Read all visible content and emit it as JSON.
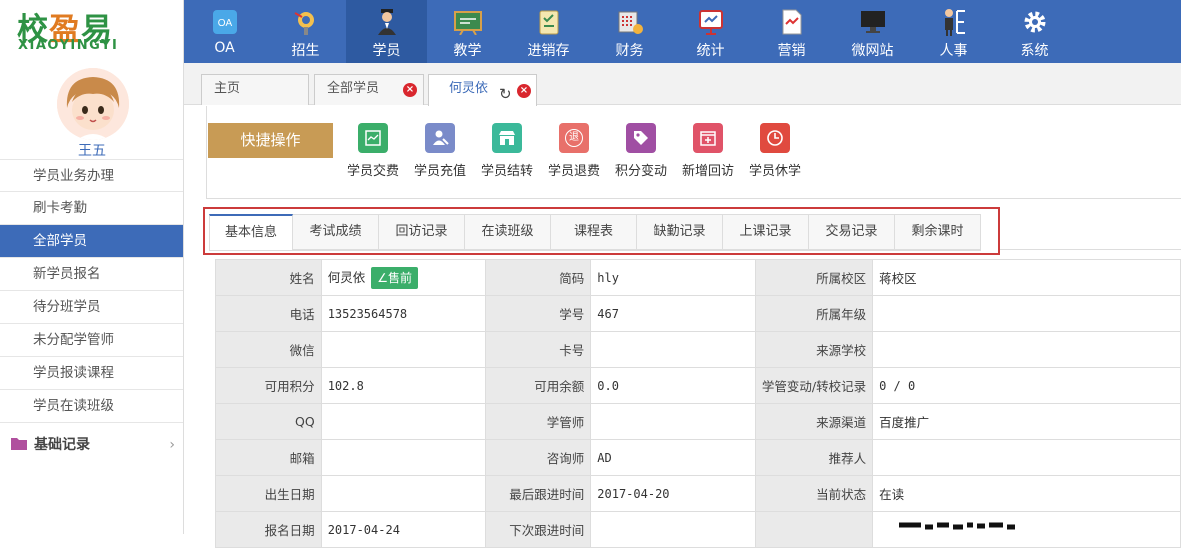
{
  "logo": {
    "cn_left": "校",
    "cn_mid": "盈",
    "cn_right": "易",
    "en": "XIAOYINGYI"
  },
  "nav": [
    {
      "label": "OA",
      "icon": "oa-icon"
    },
    {
      "label": "招生",
      "icon": "recruit-icon"
    },
    {
      "label": "学员",
      "icon": "student-icon",
      "active": true
    },
    {
      "label": "教学",
      "icon": "teaching-icon"
    },
    {
      "label": "进销存",
      "icon": "inventory-icon"
    },
    {
      "label": "财务",
      "icon": "finance-icon"
    },
    {
      "label": "统计",
      "icon": "statistics-icon"
    },
    {
      "label": "营销",
      "icon": "marketing-icon"
    },
    {
      "label": "微网站",
      "icon": "microsite-icon"
    },
    {
      "label": "人事",
      "icon": "hr-icon"
    },
    {
      "label": "系统",
      "icon": "gear-icon"
    }
  ],
  "user": {
    "name": "王五"
  },
  "sidebar": {
    "items": [
      {
        "label": "学员业务办理"
      },
      {
        "label": "刷卡考勤"
      },
      {
        "label": "全部学员",
        "active": true
      },
      {
        "label": "新学员报名"
      },
      {
        "label": "待分班学员"
      },
      {
        "label": "未分配学管师"
      },
      {
        "label": "学员报读课程"
      },
      {
        "label": "学员在读班级"
      }
    ],
    "group": {
      "label": "基础记录",
      "arrow": "›"
    }
  },
  "page_tabs": [
    {
      "label": "主页"
    },
    {
      "label": "全部学员",
      "close": "×"
    },
    {
      "label": "何灵依",
      "close": "×",
      "refresh": "↻",
      "active": true
    }
  ],
  "quick": {
    "main_label": "快捷操作",
    "actions": [
      {
        "label": "学员交费",
        "color": "#3bae6a",
        "icon": "payment-icon"
      },
      {
        "label": "学员充值",
        "color": "#7a8bc9",
        "icon": "recharge-icon"
      },
      {
        "label": "学员结转",
        "color": "#3bb99a",
        "icon": "transfer-icon"
      },
      {
        "label": "学员退费",
        "color": "#e8706a",
        "icon": "refund-icon",
        "glyph": "退"
      },
      {
        "label": "积分变动",
        "color": "#a04fa3",
        "icon": "tag-icon"
      },
      {
        "label": "新增回访",
        "color": "#e05368",
        "icon": "add-visit-icon"
      },
      {
        "label": "学员休学",
        "color": "#e04a3f",
        "icon": "clock-icon"
      }
    ]
  },
  "info_tabs": [
    "基本信息",
    "考试成绩",
    "回访记录",
    "在读班级",
    "课程表",
    "缺勤记录",
    "上课记录",
    "交易记录",
    "剩余课时"
  ],
  "info": {
    "rows": [
      [
        {
          "k": "姓名",
          "v": "何灵依",
          "badge": "∠售前"
        },
        {
          "k": "简码",
          "v": "hly"
        },
        {
          "k": "所属校区",
          "v": "蒋校区"
        }
      ],
      [
        {
          "k": "电话",
          "v": "13523564578"
        },
        {
          "k": "学号",
          "v": "467"
        },
        {
          "k": "所属年级",
          "v": ""
        }
      ],
      [
        {
          "k": "微信",
          "v": ""
        },
        {
          "k": "卡号",
          "v": ""
        },
        {
          "k": "来源学校",
          "v": ""
        }
      ],
      [
        {
          "k": "可用积分",
          "v": "102.8"
        },
        {
          "k": "可用余额",
          "v": "0.0"
        },
        {
          "k": "学管变动/转校记录",
          "v": "0 / 0"
        }
      ],
      [
        {
          "k": "QQ",
          "v": ""
        },
        {
          "k": "学管师",
          "v": ""
        },
        {
          "k": "来源渠道",
          "v": "百度推广"
        }
      ],
      [
        {
          "k": "邮箱",
          "v": ""
        },
        {
          "k": "咨询师",
          "v": "AD"
        },
        {
          "k": "推荐人",
          "v": ""
        }
      ],
      [
        {
          "k": "出生日期",
          "v": ""
        },
        {
          "k": "最后跟进时间",
          "v": "2017-04-20"
        },
        {
          "k": "当前状态",
          "v": "在读"
        }
      ],
      [
        {
          "k": "报名日期",
          "v": "2017-04-24"
        },
        {
          "k": "下次跟进时间",
          "v": ""
        },
        {
          "k": "",
          "v": ""
        }
      ]
    ]
  }
}
